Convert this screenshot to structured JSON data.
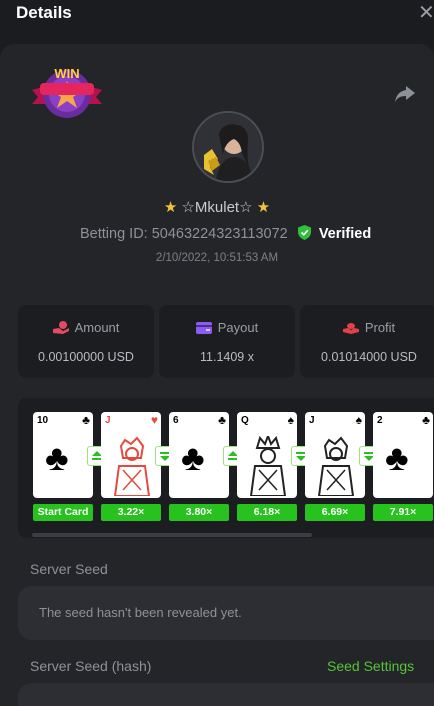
{
  "header": {
    "title": "Details",
    "close_icon": "close-icon"
  },
  "share_icon": "share-arrow-icon",
  "badge": {
    "text": "WIN"
  },
  "player": {
    "name": "☆Mkulet☆",
    "star_left": "★",
    "star_right": "★",
    "betting_id": "Betting ID: 50463224323113072",
    "verified_label": "Verified",
    "datetime": "2/10/2022, 10:51:53 AM"
  },
  "stats": [
    {
      "label": "Amount",
      "value": "0.00100000 USD",
      "icon": "coin-hand-icon",
      "color": "#e24b63"
    },
    {
      "label": "Payout",
      "value": "11.1409 x",
      "icon": "card-wallet-icon",
      "color": "#8c5cf2"
    },
    {
      "label": "Profit",
      "value": "0.01014000 USD",
      "icon": "profit-coins-icon",
      "color": "#e2414a"
    }
  ],
  "cards": [
    {
      "rank": "10",
      "suit": "♣",
      "color": "black",
      "multiplier": "Start Card"
    },
    {
      "rank": "J",
      "suit": "♥",
      "color": "red",
      "multiplier": "3.22×",
      "arrow": "up"
    },
    {
      "rank": "6",
      "suit": "♣",
      "color": "black",
      "multiplier": "3.80×",
      "arrow": "down"
    },
    {
      "rank": "Q",
      "suit": "♠",
      "color": "black",
      "multiplier": "6.18×",
      "arrow": "up"
    },
    {
      "rank": "J",
      "suit": "♠",
      "color": "black",
      "multiplier": "6.69×",
      "arrow": "down"
    },
    {
      "rank": "2",
      "suit": "♣",
      "color": "black",
      "multiplier": "7.91×",
      "arrow": "down"
    }
  ],
  "server_seed": {
    "label": "Server Seed",
    "value": "The seed hasn't been revealed yet."
  },
  "server_seed_hash": {
    "label": "Server Seed (hash)",
    "settings_link": "Seed Settings"
  },
  "colors": {
    "accent_green": "#27c21d",
    "link_green": "#54c537",
    "panel": "#232529",
    "background": "#1a1c1f"
  }
}
